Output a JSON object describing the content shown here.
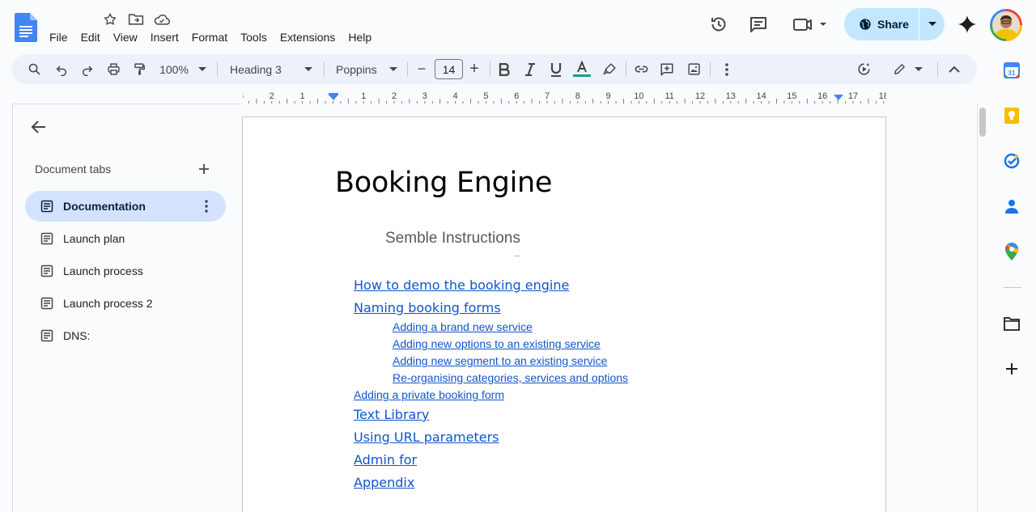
{
  "menu": [
    "File",
    "Edit",
    "View",
    "Insert",
    "Format",
    "Tools",
    "Extensions",
    "Help"
  ],
  "share": {
    "label": "Share"
  },
  "toolbar": {
    "zoom": "100%",
    "style": "Heading 3",
    "font": "Poppins",
    "font_size": "14",
    "font_size_minus": "−",
    "font_size_plus": "+",
    "text_color": "#1a9c8c"
  },
  "ruler": {
    "labels": [
      "3",
      "2",
      "1",
      "1",
      "2",
      "3",
      "4",
      "5",
      "6",
      "7",
      "8",
      "9",
      "10",
      "11",
      "12",
      "13",
      "14",
      "15",
      "16",
      "17",
      "18"
    ]
  },
  "tabs": {
    "heading": "Document tabs",
    "items": [
      {
        "label": "Documentation",
        "active": true
      },
      {
        "label": "Launch plan",
        "active": false
      },
      {
        "label": "Launch process",
        "active": false
      },
      {
        "label": "Launch process 2",
        "active": false
      },
      {
        "label": "DNS:",
        "active": false
      }
    ]
  },
  "document": {
    "title": "Booking Engine",
    "subtitle": "Semble Instructions",
    "toc": [
      {
        "text": "How to demo the booking engine",
        "level": 1
      },
      {
        "text": "Naming booking forms",
        "level": 1
      },
      {
        "text": "Adding a brand new service",
        "level": 2
      },
      {
        "text": "Adding new options to an existing service",
        "level": 2
      },
      {
        "text": "Adding new segment to an existing service",
        "level": 2
      },
      {
        "text": "Re-organising categories, services and options",
        "level": 2
      },
      {
        "text": "Adding a private booking form",
        "level": "1b"
      },
      {
        "text": "Text Library",
        "level": 1
      },
      {
        "text": "Using URL parameters",
        "level": 1
      },
      {
        "text": "Admin for ",
        "level": 1
      },
      {
        "text": "Appendix",
        "level": 1
      }
    ]
  },
  "colors": {
    "link": "#1155cc",
    "share_bg": "#c2e7ff",
    "active_tab_bg": "#d3e3fd",
    "docs_blue": "#4285f4"
  }
}
